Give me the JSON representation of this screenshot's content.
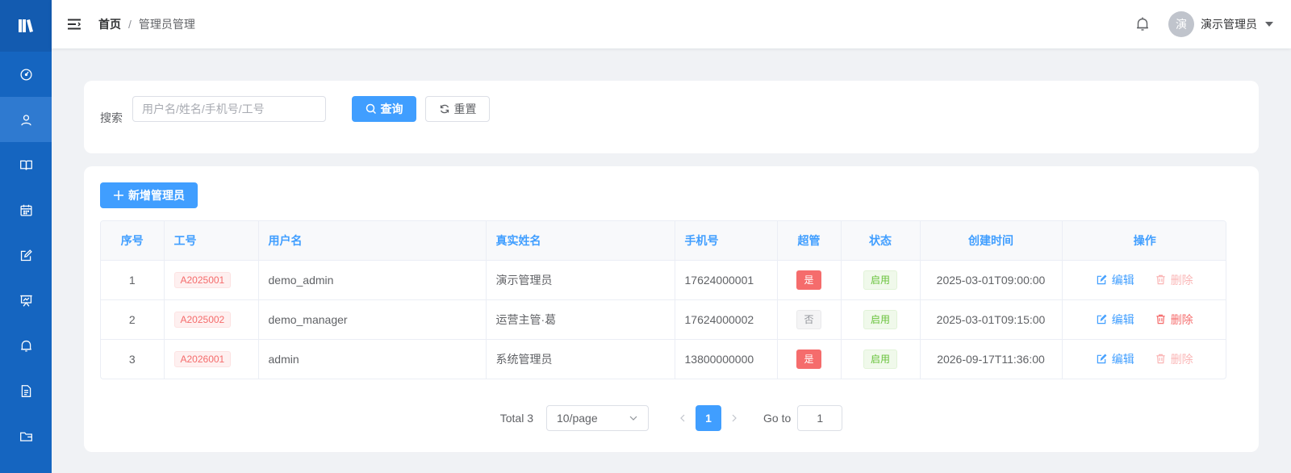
{
  "sidebar": {
    "logo_icon": "book-logo-icon",
    "items": [
      {
        "icon": "dashboard-icon",
        "active": false
      },
      {
        "icon": "user-icon",
        "active": true
      },
      {
        "icon": "book-icon",
        "active": false
      },
      {
        "icon": "calendar-icon",
        "active": false
      },
      {
        "icon": "edit-icon",
        "active": false
      },
      {
        "icon": "presentation-icon",
        "active": false
      },
      {
        "icon": "bell-icon",
        "active": false
      },
      {
        "icon": "document-icon",
        "active": false
      },
      {
        "icon": "folder-icon",
        "active": false
      }
    ]
  },
  "header": {
    "breadcrumb": {
      "home": "首页",
      "separator": "/",
      "current": "管理员管理"
    },
    "avatar_text": "演",
    "user_name": "演示管理员"
  },
  "search": {
    "label": "搜索",
    "placeholder": "用户名/姓名/手机号/工号",
    "value": "",
    "query_button": "查询",
    "reset_button": "重置"
  },
  "toolbar": {
    "add_button": "新增管理员"
  },
  "table": {
    "columns": [
      "序号",
      "工号",
      "用户名",
      "真实姓名",
      "手机号",
      "超管",
      "状态",
      "创建时间",
      "操作"
    ],
    "rows": [
      {
        "index": "1",
        "emp_id": "A2025001",
        "username": "demo_admin",
        "real_name": "演示管理员",
        "phone": "17624000001",
        "super": "是",
        "status": "启用",
        "created": "2025-03-01T09:00:00",
        "edit": "编辑",
        "delete": "删除",
        "delete_disabled": true
      },
      {
        "index": "2",
        "emp_id": "A2025002",
        "username": "demo_manager",
        "real_name": "运营主管·葛",
        "phone": "17624000002",
        "super": "否",
        "status": "启用",
        "created": "2025-03-01T09:15:00",
        "edit": "编辑",
        "delete": "删除",
        "delete_disabled": false
      },
      {
        "index": "3",
        "emp_id": "A2026001",
        "username": "admin",
        "real_name": "系统管理员",
        "phone": "13800000000",
        "super": "是",
        "status": "启用",
        "created": "2026-09-17T11:36:00",
        "edit": "编辑",
        "delete": "删除",
        "delete_disabled": true
      }
    ]
  },
  "pagination": {
    "total": "Total 3",
    "page_size": "10/page",
    "current_page": "1",
    "goto_label": "Go to",
    "goto_value": "1"
  },
  "colors": {
    "sidebar": "#1565c0",
    "primary": "#409eff",
    "danger": "#f56c6c",
    "success": "#67c23a"
  }
}
